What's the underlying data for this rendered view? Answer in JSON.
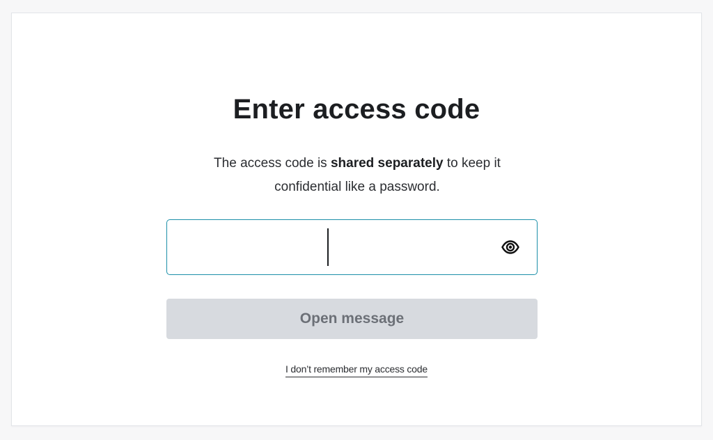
{
  "dialog": {
    "title": "Enter access code",
    "description": {
      "before": "The access code is ",
      "emphasis": "shared separately",
      "after": " to keep it confidential like a password."
    },
    "access_code_field": {
      "value": "",
      "placeholder": "",
      "toggle_icon": "eye-icon",
      "focused_border_color": "#1b8fa8"
    },
    "open_button": {
      "label": "Open message",
      "state": "disabled",
      "background": "#d7dadf",
      "text_color": "#6c7077"
    },
    "forgot_link": {
      "label": "I don’t remember my access code"
    }
  }
}
